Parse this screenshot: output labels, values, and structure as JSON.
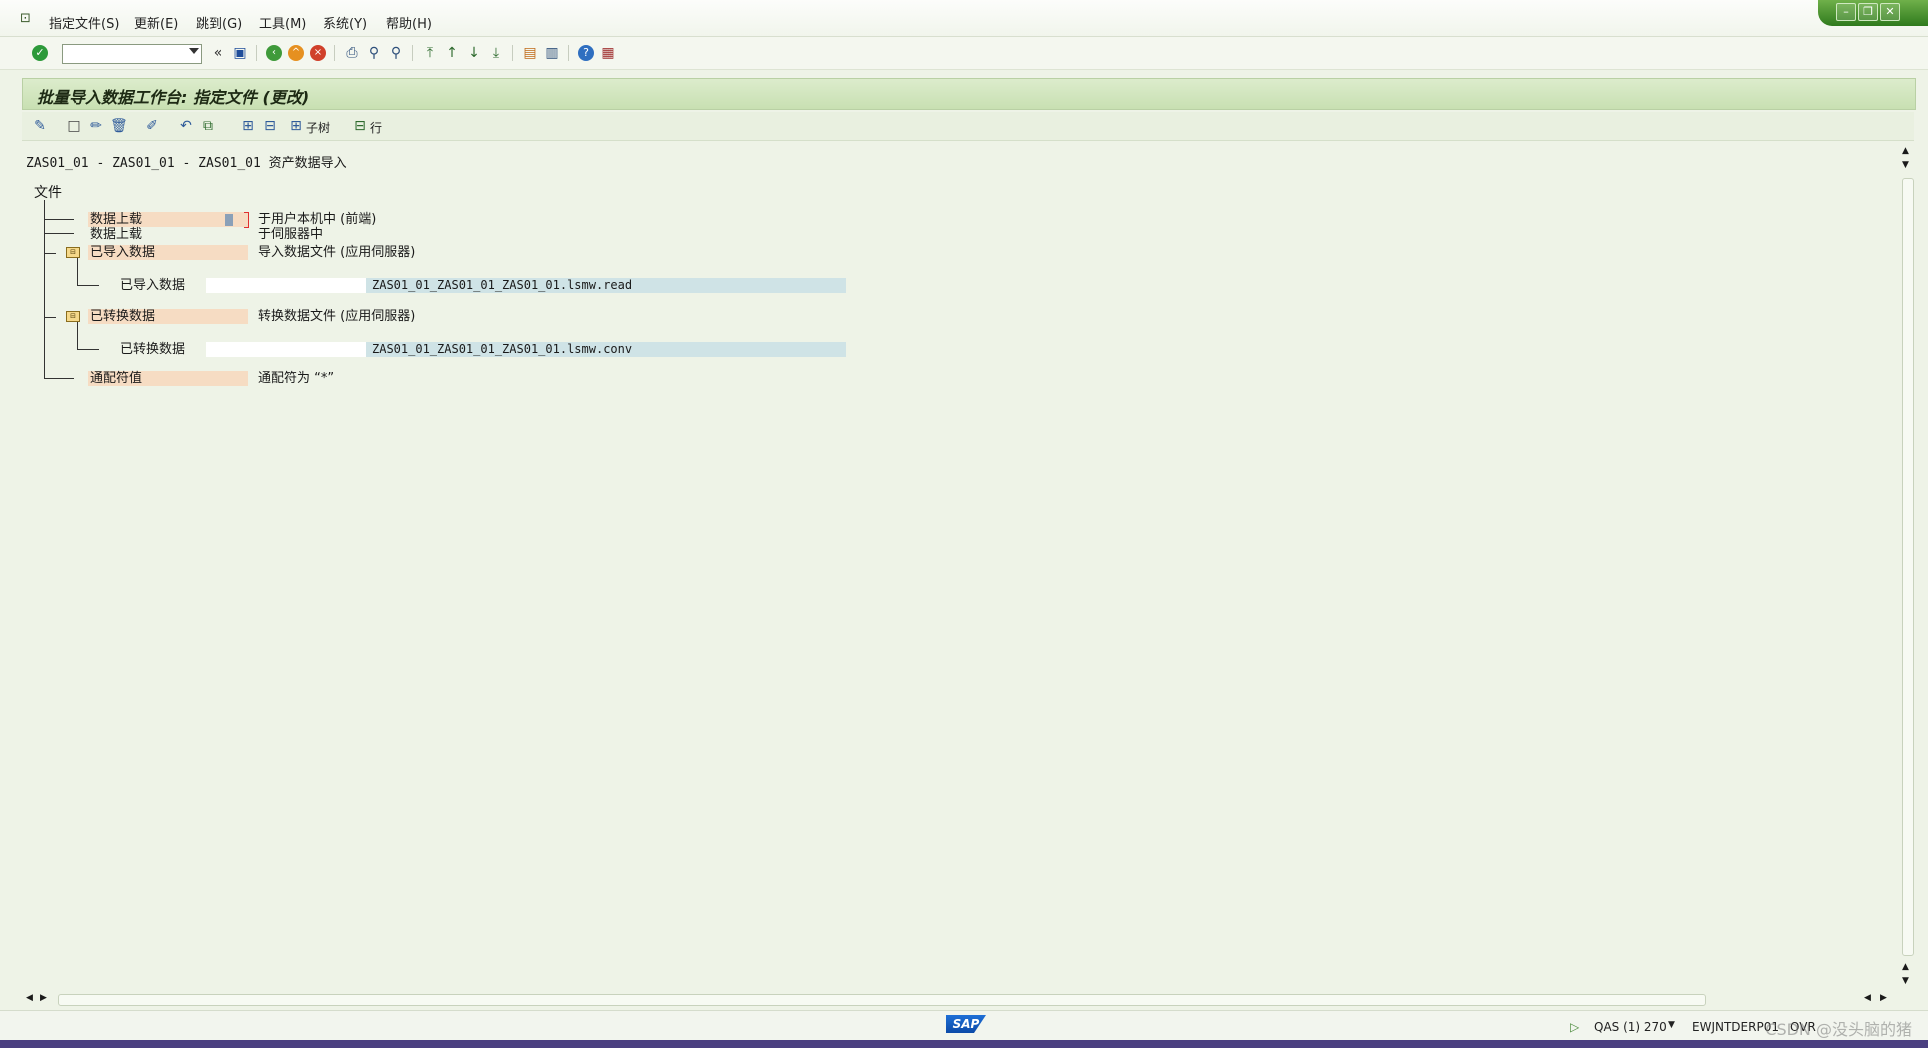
{
  "menu": {
    "items": [
      "指定文件(S)",
      "更新(E)",
      "跳到(G)",
      "工具(M)",
      "系统(Y)",
      "帮助(H)"
    ]
  },
  "window": {
    "title": "批量导入数据工作台: 指定文件 (更改)"
  },
  "app_toolbar": {
    "subtree_label": "子树",
    "row_label": "行"
  },
  "content": {
    "header": "ZAS01_01 - ZAS01_01 - ZAS01_01 资产数据导入",
    "files_label": "文件",
    "nodes": [
      {
        "label": "数据上载",
        "desc": "于用户本机中 (前端)"
      },
      {
        "label": "数据上载",
        "desc": "于伺服器中"
      },
      {
        "label": "已导入数据",
        "desc": "导入数据文件 (应用伺服器)"
      },
      {
        "label": "已导入数据",
        "file": "ZAS01_01_ZAS01_01_ZAS01_01.lsmw.read"
      },
      {
        "label": "已转换数据",
        "desc": "转换数据文件 (应用伺服器)"
      },
      {
        "label": "已转换数据",
        "file": "ZAS01_01_ZAS01_01_ZAS01_01.lsmw.conv"
      },
      {
        "label": "通配符值",
        "desc": "通配符为 “*”"
      }
    ]
  },
  "status": {
    "logo": "SAP",
    "system": "QAS (1) 270",
    "host": "EWJNTDERP01",
    "mode": "OVR"
  },
  "watermark": "CSDN @没头脑的猪",
  "icons": {
    "enter": "check-icon",
    "save": "save-icon",
    "back": "back-icon",
    "exit": "exit-icon",
    "cancel": "cancel-icon",
    "print": "print-icon",
    "find": "find-icon",
    "help": "help-icon"
  },
  "colors": {
    "node_label_bg": "#f6dcc3",
    "file_box_bg": "#cfe3e6",
    "title_bg": "#c8e0b2",
    "window_green": "#2f7a1d"
  }
}
